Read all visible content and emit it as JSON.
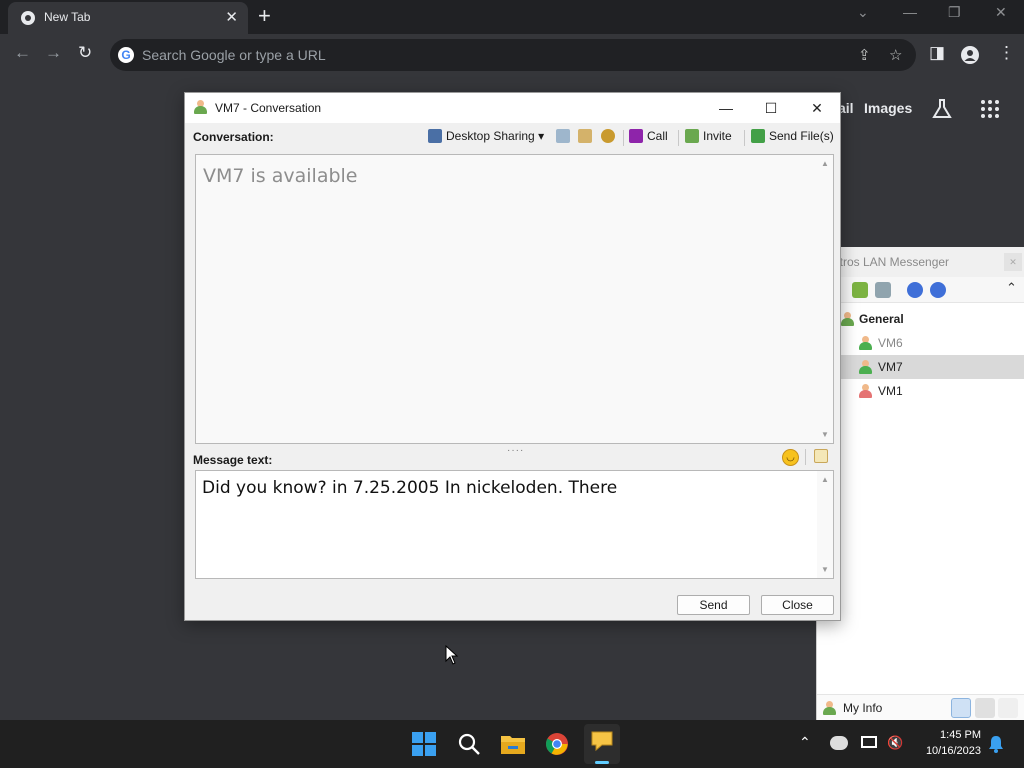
{
  "browser": {
    "tab_title": "New Tab",
    "tab_close": "✕",
    "new_tab": "+",
    "omnibox_placeholder": "Search Google or type a URL",
    "page_links": {
      "gmail_partial": "ail",
      "images": "Images"
    }
  },
  "lan_messenger": {
    "title_partial": "ltros LAN Messenger",
    "tree": {
      "group": "General",
      "users": [
        {
          "name": "VM6",
          "status": "online",
          "selected": false
        },
        {
          "name": "VM7",
          "status": "online",
          "selected": true
        },
        {
          "name": "VM1",
          "status": "away",
          "selected": false
        }
      ]
    },
    "footer": {
      "my_info": "My Info"
    }
  },
  "conversation": {
    "title": "VM7 - Conversation",
    "conversation_label": "Conversation:",
    "toolbar": {
      "desktop_sharing": "Desktop Sharing",
      "call": "Call",
      "invite": "Invite",
      "send_files": "Send File(s)"
    },
    "history_status": "VM7 is available",
    "message_label": "Message text:",
    "message_value": "Did you know? in 7.25.2005 In nickeloden. There",
    "send_button": "Send",
    "close_button": "Close"
  },
  "taskbar": {
    "time": "1:45 PM",
    "date": "10/16/2023"
  },
  "colors": {
    "chrome_dark": "#202124",
    "chrome_surface": "#35363a",
    "windows_accent": "#0078d4",
    "online_green": "#4caf50",
    "away_pink": "#e57373"
  }
}
